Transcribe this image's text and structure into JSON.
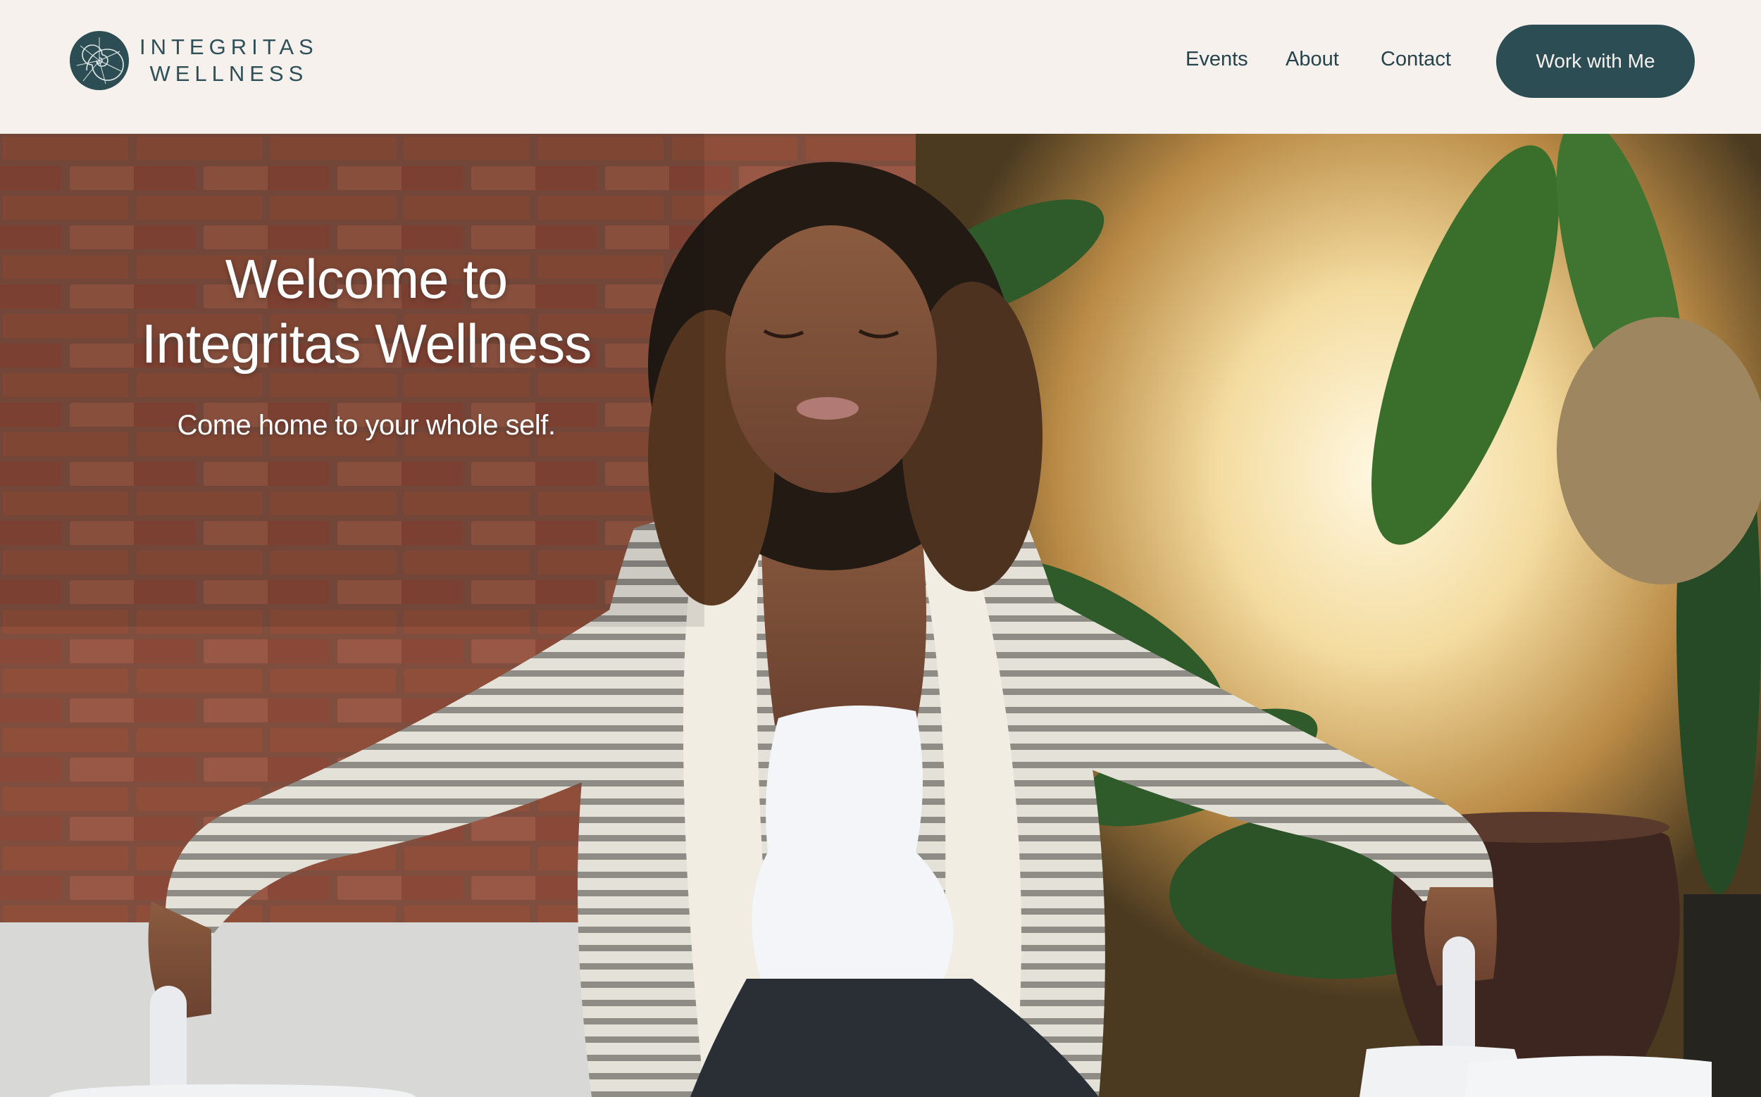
{
  "brand": {
    "line1": "INTEGRITAS",
    "line2": "WELLNESS"
  },
  "nav": {
    "events": "Events",
    "about": "About",
    "contact": "Contact",
    "cta": "Work with Me"
  },
  "hero": {
    "title_line1": "Welcome to",
    "title_line2": "Integritas Wellness",
    "subtitle": "Come home to your whole self."
  },
  "colors": {
    "header_bg": "#f6f1ec",
    "brand_teal": "#2d4d55",
    "nav_text": "#26434b",
    "hero_text": "#ffffff"
  }
}
